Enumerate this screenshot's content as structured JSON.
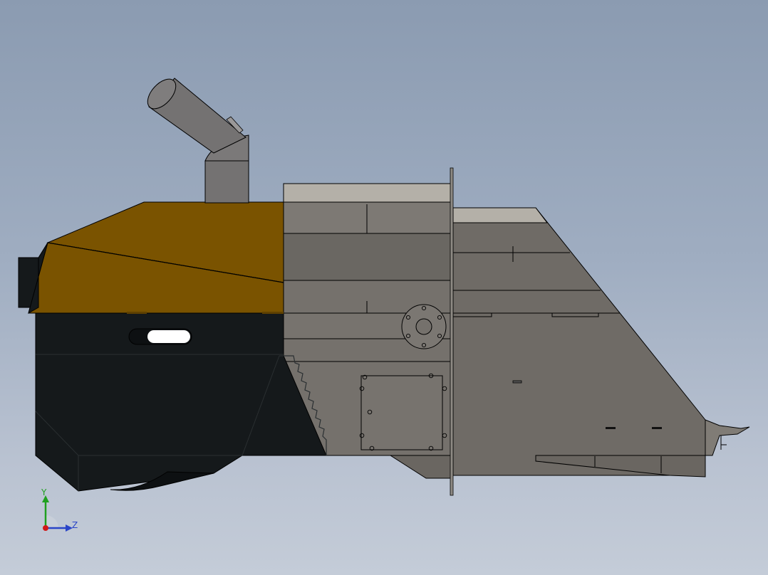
{
  "viewport": {
    "background_top": "#8b9bb1",
    "background_bottom": "#c4ccd8"
  },
  "model": {
    "colors": {
      "cover_brown": "#7a5300",
      "body_black": "#15191b",
      "hopper_gray": "#75716c",
      "chute_gray": "#6f6b66",
      "pipe_gray": "#747272",
      "light_gray": "#b4b0a8",
      "outline": "#000000"
    }
  },
  "triad": {
    "y_label": "Y",
    "z_label": "Z",
    "colors": {
      "y": "#1fa01f",
      "z": "#2a45c8",
      "x": "#d01818"
    }
  }
}
